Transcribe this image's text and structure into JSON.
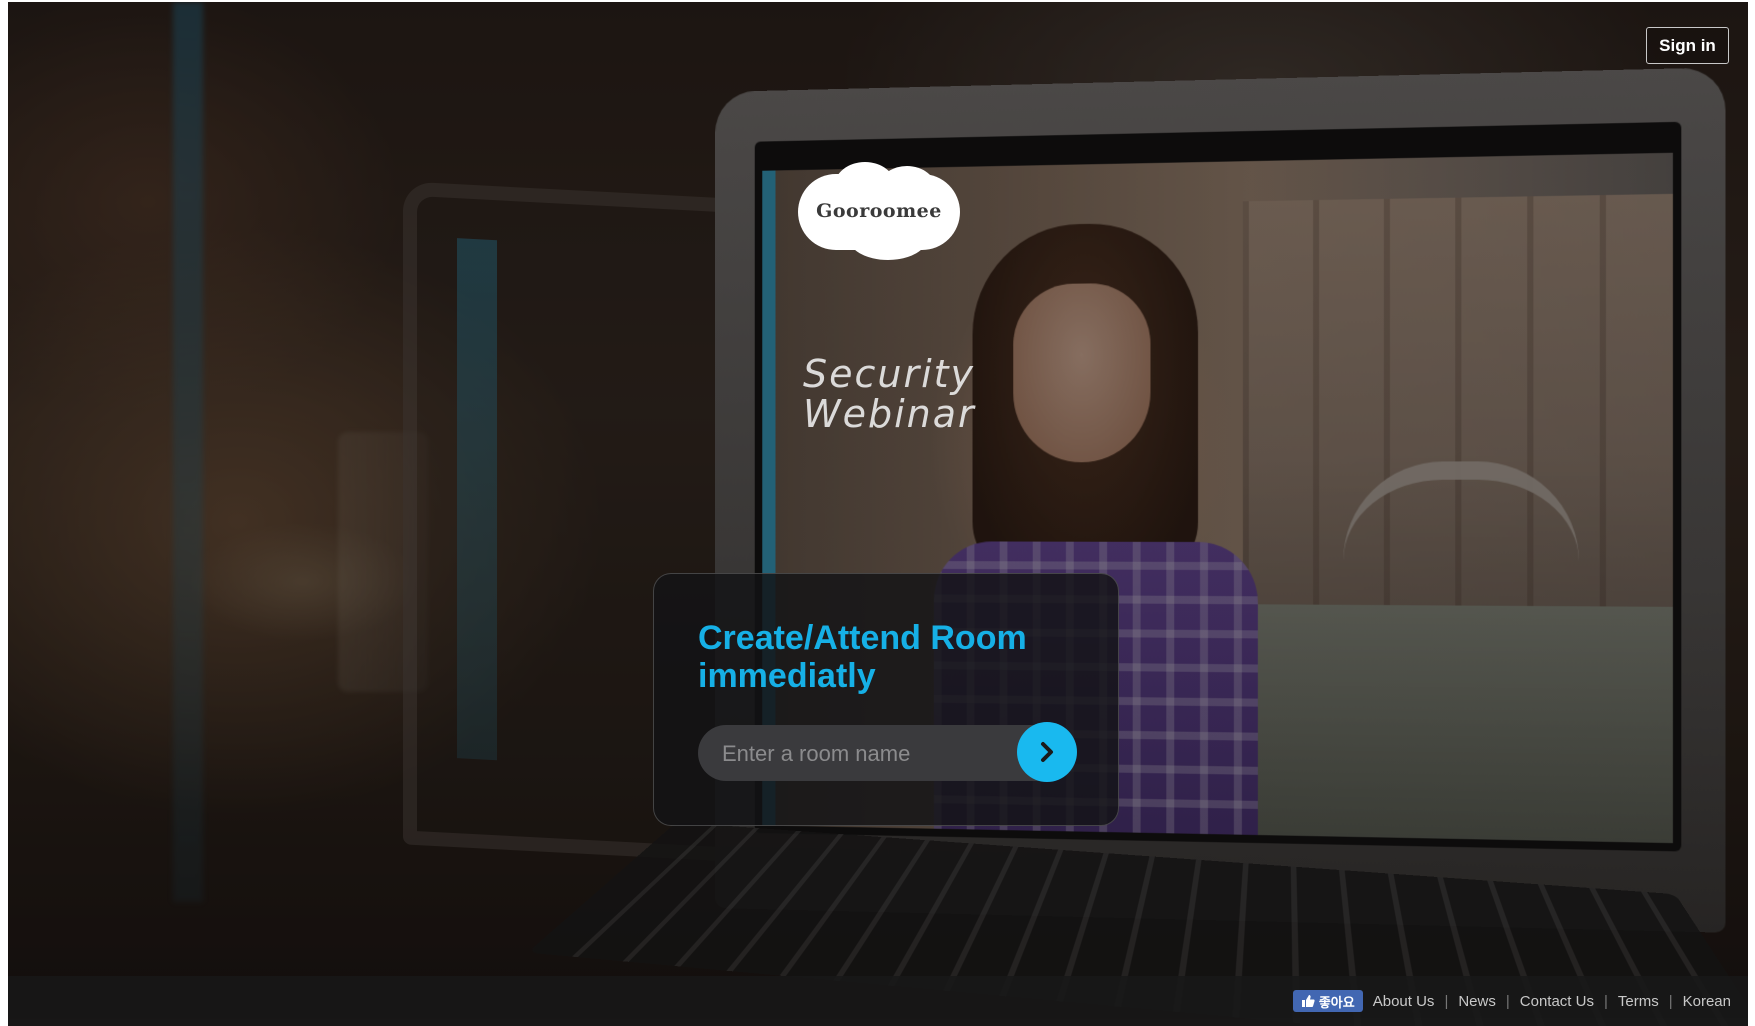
{
  "header": {
    "sign_in_label": "Sign in"
  },
  "logo": {
    "text": "Gooroomee"
  },
  "hero": {
    "webinar_line1": "Security",
    "webinar_line2": "Webinar"
  },
  "room_card": {
    "title_line1": "Create/Attend Room",
    "title_line2": "immediatly",
    "input_placeholder": "Enter a room name",
    "input_value": "",
    "go_icon": "chevron-right-icon"
  },
  "footer": {
    "like_label": "좋아요",
    "like_icon": "thumbs-up-icon",
    "links": [
      "About Us",
      "News",
      "Contact Us",
      "Terms",
      "Korean"
    ]
  },
  "colors": {
    "accent": "#19b9ef",
    "title": "#16b0e6",
    "facebook": "#4267b2"
  }
}
